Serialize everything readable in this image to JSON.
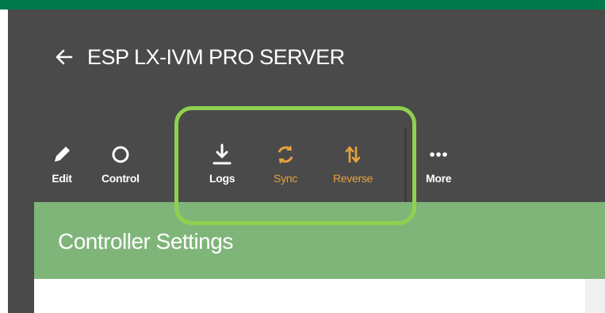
{
  "header": {
    "title": "ESP LX-IVM PRO SERVER",
    "accent_color": "#007a4d",
    "background_color": "#4a4a4a"
  },
  "toolbar": {
    "items": [
      {
        "label": "Edit",
        "icon": "pencil-icon",
        "color": "#ffffff"
      },
      {
        "label": "Control",
        "icon": "circle-icon",
        "color": "#ffffff"
      },
      {
        "label": "Logs",
        "icon": "download-icon",
        "color": "#ffffff"
      },
      {
        "label": "Sync",
        "icon": "sync-icon",
        "color": "#e8a23a"
      },
      {
        "label": "Reverse",
        "icon": "swap-vertical-icon",
        "color": "#e8a23a"
      },
      {
        "label": "More",
        "icon": "more-horizontal-icon",
        "color": "#ffffff"
      }
    ],
    "highlight_color": "#8fd14f"
  },
  "settings": {
    "title": "Controller Settings",
    "band_color": "#80b57a"
  }
}
